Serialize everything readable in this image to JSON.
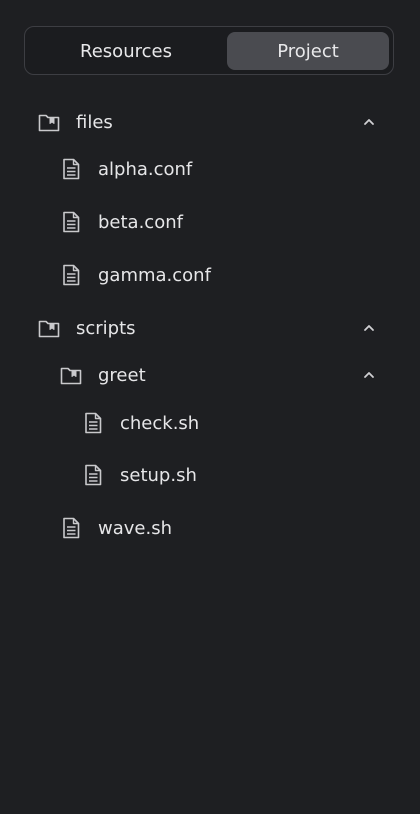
{
  "tabs": {
    "resources_label": "Resources",
    "project_label": "Project",
    "selected": "Project"
  },
  "tree": {
    "files": {
      "label": "files",
      "expanded": true,
      "children": [
        "alpha.conf",
        "beta.conf",
        "gamma.conf"
      ]
    },
    "scripts": {
      "label": "scripts",
      "expanded": true,
      "greet": {
        "label": "greet",
        "expanded": true,
        "children": [
          "check.sh",
          "setup.sh"
        ]
      },
      "children": [
        "wave.sh"
      ]
    }
  },
  "icons": {
    "folder": "folder-icon",
    "file": "file-icon",
    "chevron": "chevron-up-icon"
  },
  "colors": {
    "background": "#1e1f22",
    "selected_tab": "#4a4b50",
    "text": "#e6e6e8",
    "icon": "#c9c9cc"
  }
}
